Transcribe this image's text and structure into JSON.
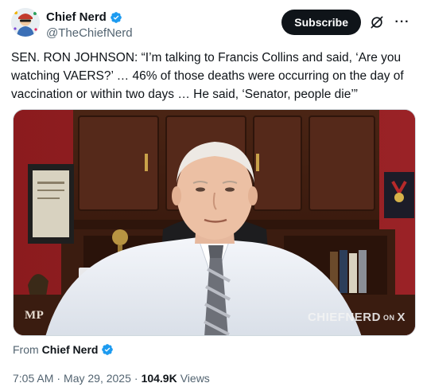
{
  "post": {
    "author_name": "Chief Nerd",
    "handle": "@TheChiefNerd",
    "subscribe_label": "Subscribe",
    "text": "SEN. RON JOHNSON: “I’m talking to Francis Collins and said, ‘Are you watching VAERS?’ … 46% of those deaths were occurring on the day of vaccination or within two days … He said, ‘Senator, people die’”",
    "media": {
      "watermark_left": "MP",
      "watermark_right": "CHIEFNERD",
      "watermark_right_small": "ON",
      "watermark_right_x": "X"
    },
    "from_label": "From",
    "from_name": "Chief Nerd",
    "time": "7:05 AM",
    "date": "May 29, 2025",
    "separator": "·",
    "views_count": "104.9K",
    "views_label": "Views"
  },
  "colors": {
    "verified": "#1d9bf0",
    "subscribe_bg": "#0f1419",
    "secondary_text": "#536471"
  },
  "icons": {
    "verified": "verified-badge-icon",
    "grok": "grok-icon",
    "more": "more-icon"
  }
}
